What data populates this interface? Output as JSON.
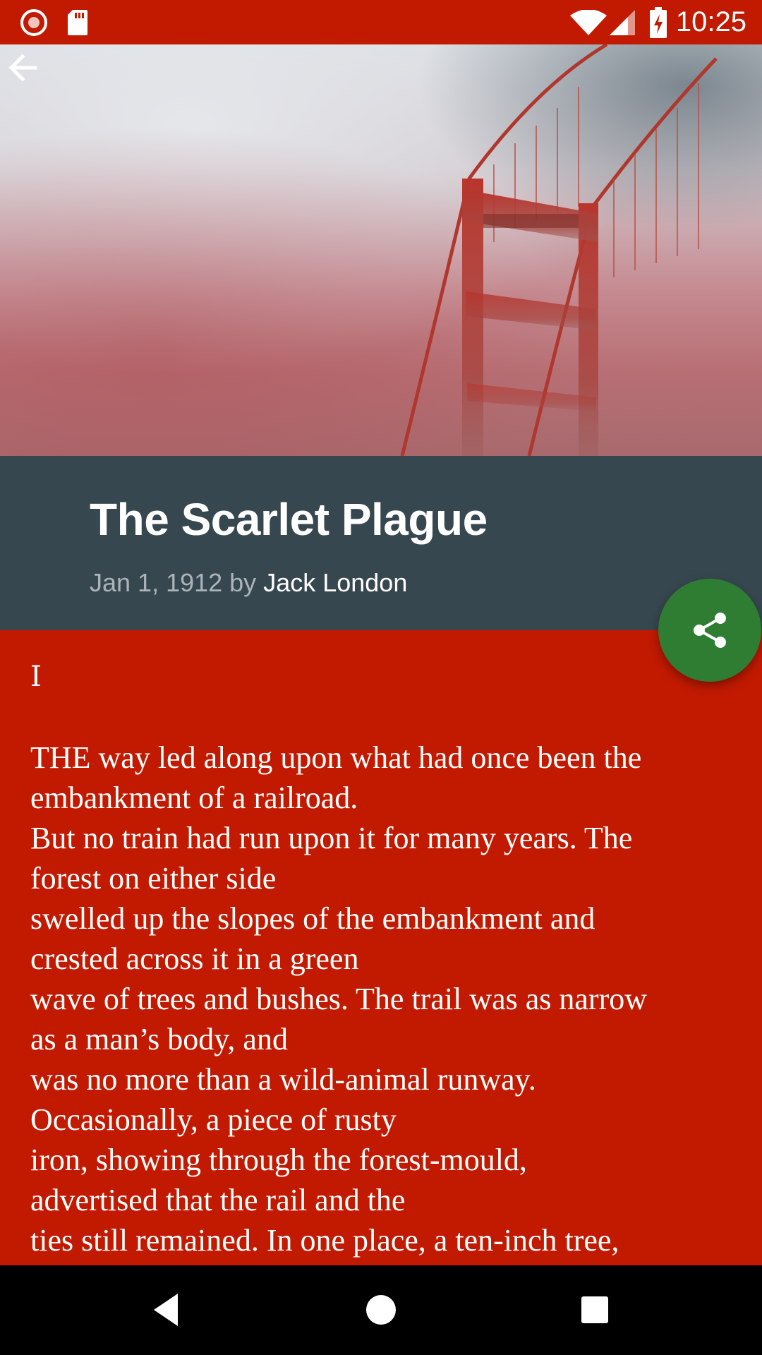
{
  "status_bar": {
    "time": "10:25",
    "icons": [
      "record-icon",
      "sdcard-icon",
      "wifi-icon",
      "signal-icon",
      "battery-charging-icon"
    ]
  },
  "toolbar": {
    "back_icon": "arrow-left-icon"
  },
  "hero": {
    "image": "foggy-suspension-bridge-tower-photo"
  },
  "article": {
    "title": "The Scarlet Plague",
    "date_by": "Jan 1, 1912 by ",
    "author": "Jack London",
    "chapter": "I",
    "lines": [
      "THE way led along upon what had once been the",
      "embankment of a railroad.",
      "But no train had run upon it for many years. The",
      "forest on either side",
      "swelled up the slopes of the embankment and",
      "crested across it in a green",
      "wave of trees and bushes. The trail was as narrow",
      "as a man’s body, and",
      "was no more than a wild-animal runway.",
      "Occasionally, a piece of rusty",
      "iron, showing through the forest-mould,",
      "advertised that the rail and the",
      "ties still remained. In one place, a ten-inch tree,"
    ]
  },
  "fab": {
    "icon": "share-icon"
  },
  "nav_bar": {
    "icons": [
      "nav-back-icon",
      "nav-home-icon",
      "nav-recents-icon"
    ]
  },
  "colors": {
    "primary": "#c21a00",
    "title_panel": "#37474f",
    "fab": "#2e7d32",
    "meta_text": "#aab4b9",
    "text": "#ffffff"
  }
}
